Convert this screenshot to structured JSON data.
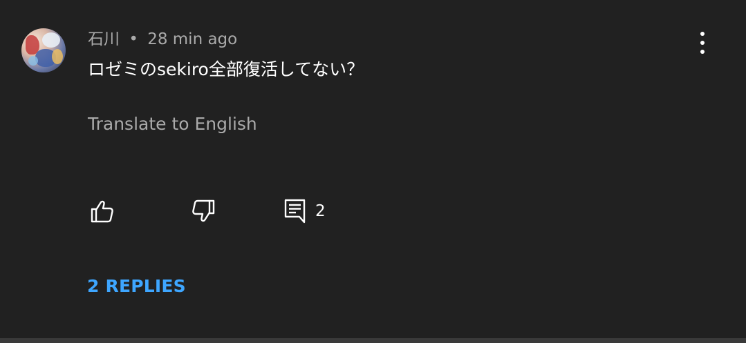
{
  "comment": {
    "author": "石川",
    "separator": "•",
    "time": "28 min ago",
    "text": "ロゼミのsekiro全部復活してない？",
    "translate_label": "Translate to English",
    "reply_count": "2",
    "replies_label": "2 REPLIES"
  },
  "icons": {
    "like": "thumbs-up-icon",
    "dislike": "thumbs-down-icon",
    "reply": "comment-icon",
    "menu": "more-vert-icon"
  },
  "colors": {
    "background": "#212121",
    "primary_text": "#ffffff",
    "secondary_text": "#aaaaaa",
    "link": "#3ea6ff"
  }
}
